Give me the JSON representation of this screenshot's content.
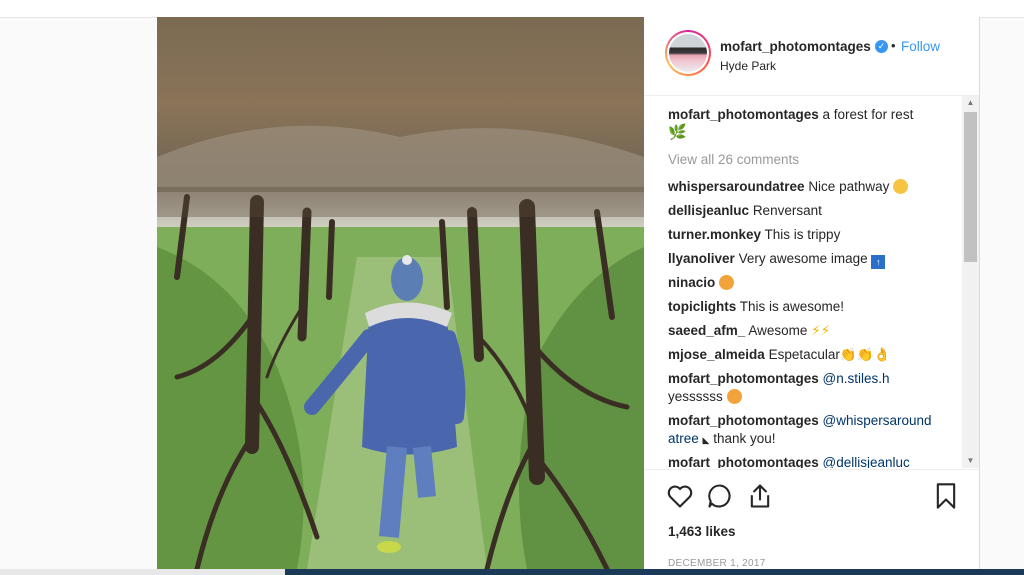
{
  "post": {
    "username": "mofart_photomontages",
    "follow_label": "Follow",
    "location": "Hyde Park",
    "caption_user": "mofart_photomontages",
    "caption_text": "a forest for rest",
    "view_all": "View all 26 comments",
    "comments": [
      {
        "user": "whispersaroundatree",
        "text": "Nice pathway"
      },
      {
        "user": "dellisjeanluc",
        "text": "Renversant"
      },
      {
        "user": "turner.monkey",
        "text": "This is trippy"
      },
      {
        "user": "llyanoliver",
        "text": "Very awesome image"
      },
      {
        "user": "ninacio",
        "text": ""
      },
      {
        "user": "topiclights",
        "text": "This is awesome!"
      },
      {
        "user": "saeed_afm_",
        "text": "Awesome"
      },
      {
        "user": "mjose_almeida",
        "text": "Espetacular"
      },
      {
        "user": "mofart_photomontages",
        "text": "@n.stiles.h",
        "text2": "yessssss"
      },
      {
        "user": "mofart_photomontages",
        "text": "@whispersaround",
        "text2": "atree",
        "text3": "thank you!"
      },
      {
        "user": "mofart_photomontages",
        "text": "@dellisjeanluc"
      }
    ],
    "likes": "1,463 likes",
    "date": "DECEMBER 1, 2017"
  },
  "icons": [
    "heart-icon",
    "comment-icon",
    "share-icon",
    "bookmark-icon",
    "verified-badge-icon"
  ],
  "colors": {
    "link": "#3897f0",
    "muted": "#999999",
    "text": "#262626"
  }
}
